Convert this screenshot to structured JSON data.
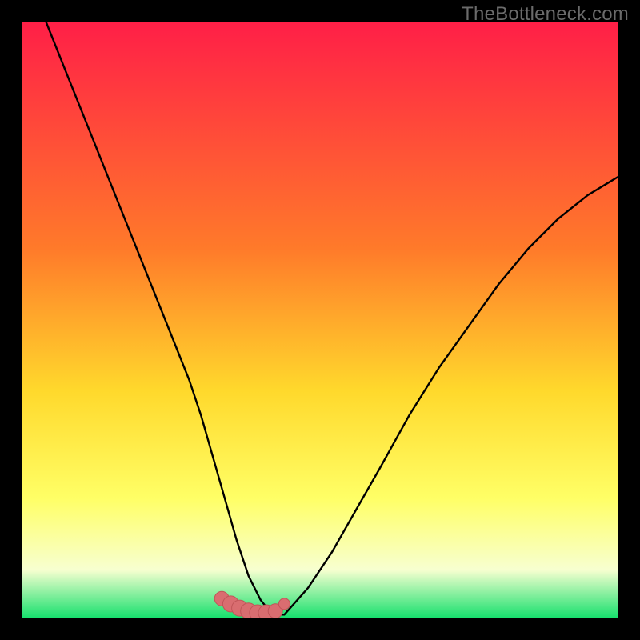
{
  "watermark": "TheBottleneck.com",
  "colors": {
    "bg": "#000000",
    "grad_top": "#ff1f47",
    "grad_mid1": "#ff7a2a",
    "grad_mid2": "#ffd92c",
    "grad_mid3": "#ffff66",
    "grad_mid4": "#f7ffd0",
    "grad_bottom": "#18e06e",
    "curve": "#000000",
    "marker_fill": "#d96d70",
    "marker_stroke": "#c05558"
  },
  "chart_data": {
    "type": "line",
    "title": "",
    "xlabel": "",
    "ylabel": "",
    "xlim": [
      0,
      100
    ],
    "ylim": [
      0,
      100
    ],
    "grid": false,
    "legend": false,
    "series": [
      {
        "name": "bottleneck-curve",
        "x": [
          0,
          4,
          8,
          12,
          16,
          20,
          24,
          28,
          30,
          32,
          34,
          36,
          38,
          40,
          42,
          44,
          48,
          52,
          56,
          60,
          65,
          70,
          75,
          80,
          85,
          90,
          95,
          100
        ],
        "y": [
          110,
          100,
          90,
          80,
          70,
          60,
          50,
          40,
          34,
          27,
          20,
          13,
          7,
          3,
          0.5,
          0.5,
          5,
          11,
          18,
          25,
          34,
          42,
          49,
          56,
          62,
          67,
          71,
          74
        ]
      }
    ],
    "markers": {
      "name": "optimal-range",
      "x": [
        33.5,
        35,
        36.5,
        38,
        39.5,
        41,
        42.5,
        44
      ],
      "y": [
        3.2,
        2.3,
        1.6,
        1.1,
        0.8,
        0.8,
        1.1,
        2.3
      ],
      "size": [
        9,
        10,
        10,
        10,
        10,
        10,
        9,
        7
      ]
    }
  }
}
